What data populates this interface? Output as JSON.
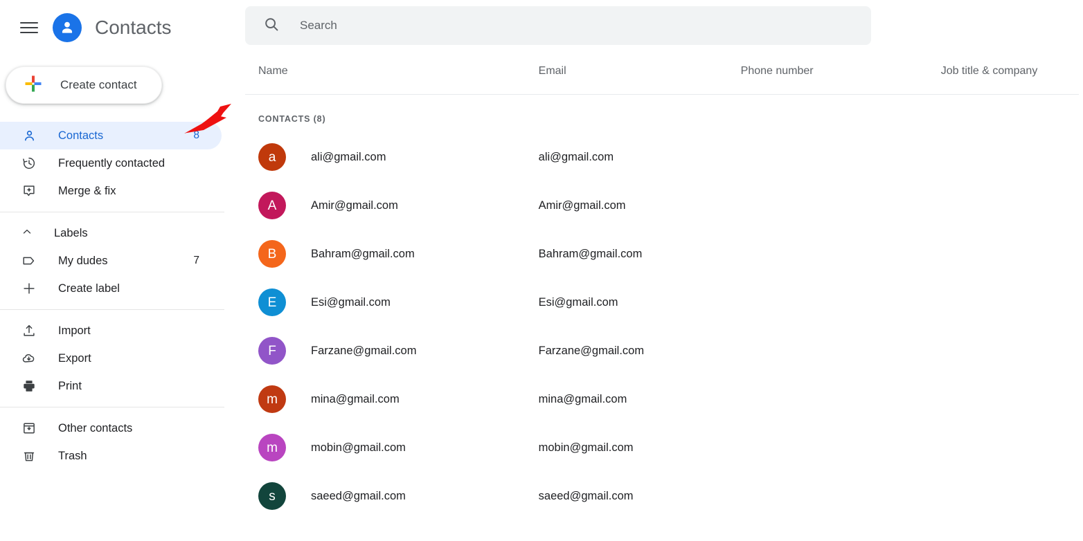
{
  "header": {
    "menu_icon": "hamburger-menu-icon",
    "logo_icon": "contacts-person-logo-icon",
    "title": "Contacts"
  },
  "create_button": {
    "label": "Create contact",
    "icon": "google-plus-icon"
  },
  "sidebar": {
    "primary_items": [
      {
        "label": "Contacts",
        "count": "8",
        "icon": "person-icon",
        "active": true
      },
      {
        "label": "Frequently contacted",
        "count": "",
        "icon": "history-clock-icon",
        "active": false
      },
      {
        "label": "Merge & fix",
        "count": "",
        "icon": "merge-sparkle-icon",
        "active": false
      }
    ],
    "labels_section": {
      "header": "Labels",
      "header_icon": "chevron-up-icon",
      "items": [
        {
          "label": "My dudes",
          "count": "7",
          "icon": "label-tag-icon"
        },
        {
          "label": "Create label",
          "count": "",
          "icon": "plus-icon"
        }
      ]
    },
    "tools_items": [
      {
        "label": "Import",
        "count": "",
        "icon": "upload-icon"
      },
      {
        "label": "Export",
        "count": "",
        "icon": "cloud-download-icon"
      },
      {
        "label": "Print",
        "count": "",
        "icon": "printer-icon"
      }
    ],
    "footer_items": [
      {
        "label": "Other contacts",
        "count": "",
        "icon": "archive-box-icon"
      },
      {
        "label": "Trash",
        "count": "",
        "icon": "trash-icon"
      }
    ]
  },
  "search": {
    "placeholder": "Search",
    "value": "",
    "icon": "search-icon"
  },
  "table": {
    "columns": [
      "Name",
      "Email",
      "Phone number",
      "Job title & company"
    ],
    "group_label": "CONTACTS (8)",
    "rows": [
      {
        "initial": "a",
        "name": "ali@gmail.com",
        "email": "ali@gmail.com",
        "phone": "",
        "job": "",
        "color": "#c0390b"
      },
      {
        "initial": "A",
        "name": "Amir@gmail.com",
        "email": "Amir@gmail.com",
        "phone": "",
        "job": "",
        "color": "#c2185b"
      },
      {
        "initial": "B",
        "name": "Bahram@gmail.com",
        "email": "Bahram@gmail.com",
        "phone": "",
        "job": "",
        "color": "#f4661b"
      },
      {
        "initial": "E",
        "name": "Esi@gmail.com",
        "email": "Esi@gmail.com",
        "phone": "",
        "job": "",
        "color": "#0f8fd4"
      },
      {
        "initial": "F",
        "name": "Farzane@gmail.com",
        "email": "Farzane@gmail.com",
        "phone": "",
        "job": "",
        "color": "#9155c8"
      },
      {
        "initial": "m",
        "name": "mina@gmail.com",
        "email": "mina@gmail.com",
        "phone": "",
        "job": "",
        "color": "#c03a12"
      },
      {
        "initial": "m",
        "name": "mobin@gmail.com",
        "email": "mobin@gmail.com",
        "phone": "",
        "job": "",
        "color": "#b945c0"
      },
      {
        "initial": "s",
        "name": "saeed@gmail.com",
        "email": "saeed@gmail.com",
        "phone": "",
        "job": "",
        "color": "#12453c"
      }
    ]
  },
  "annotation": {
    "arrow_color": "#ee1111",
    "points_at": "Contacts"
  },
  "colors": {
    "accent_blue": "#1a73e8",
    "active_pill": "#e8f0fe",
    "active_text": "#1967d2",
    "search_bg": "#f1f3f4",
    "text_primary": "#202124",
    "text_secondary": "#5f6368"
  }
}
